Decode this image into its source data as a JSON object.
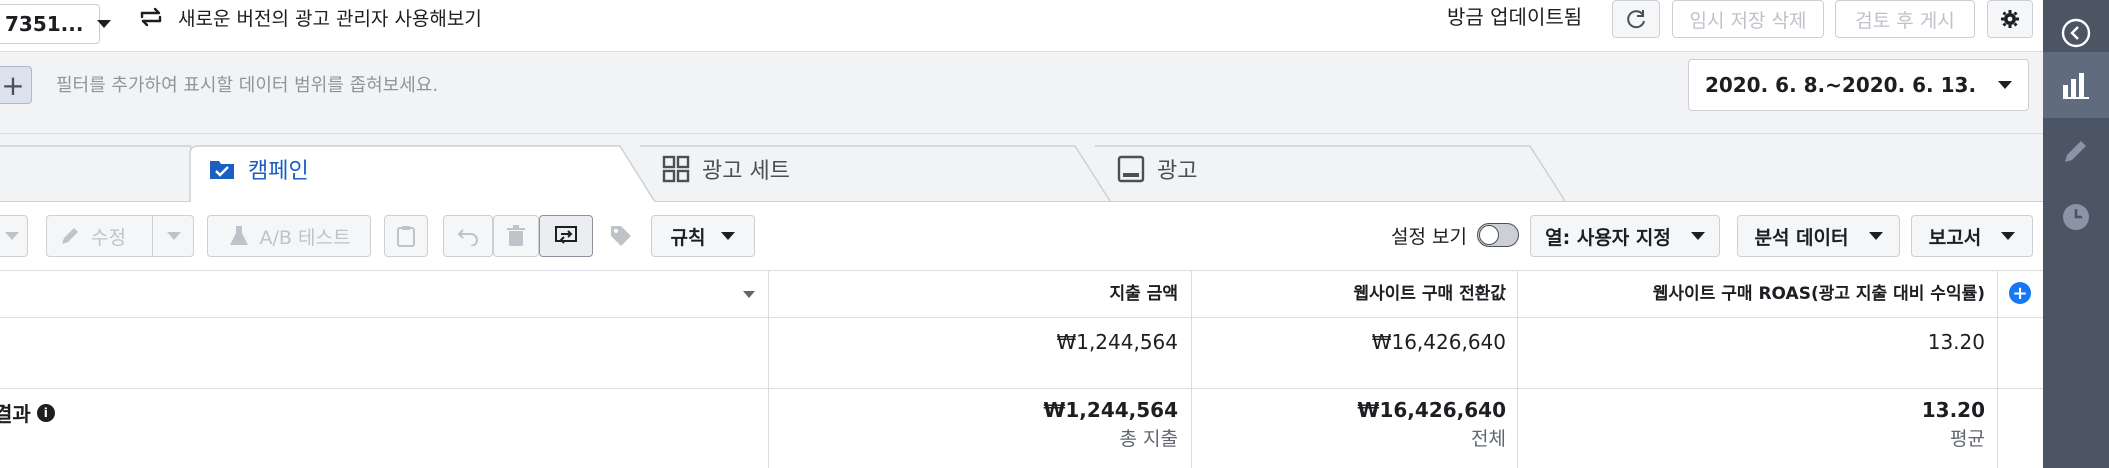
{
  "topbar": {
    "account_label": "7351...",
    "new_version_label": "새로운 버전의 광고 관리자 사용해보기",
    "updated_label": "방금 업데이트됨",
    "discard_drafts_label": "임시 저장 삭제",
    "review_publish_label": "검토 후 게시"
  },
  "filter": {
    "placeholder": "필터를 추가하여 표시할 데이터 범위를 좁혀보세요.",
    "date_range": "2020. 6. 8.~2020. 6. 13."
  },
  "tabs": [
    {
      "label": "캠페인",
      "active": true
    },
    {
      "label": "광고 세트",
      "active": false
    },
    {
      "label": "광고",
      "active": false
    }
  ],
  "toolbar": {
    "edit_label": "수정",
    "ab_test_label": "A/B 테스트",
    "rules_label": "규칙",
    "view_setup_label": "설정 보기",
    "columns_label": "열: 사용자 지정",
    "breakdown_label": "분석 데이터",
    "reports_label": "보고서"
  },
  "table": {
    "headers": [
      "지출 금액",
      "웹사이트 구매 전환값",
      "웹사이트 구매 ROAS(광고 지출 대비 수익률)"
    ],
    "row": [
      "₩1,244,564",
      "₩16,426,640",
      "13.20"
    ],
    "totals_label": "결과",
    "totals": [
      {
        "value": "₩1,244,564",
        "sub": "총 지출"
      },
      {
        "value": "₩16,426,640",
        "sub": "전체"
      },
      {
        "value": "13.20",
        "sub": "평균"
      }
    ]
  },
  "colors": {
    "accent": "#1877f2",
    "sidebar": "#4b5563",
    "tab_active_text": "#1b5fc2"
  }
}
